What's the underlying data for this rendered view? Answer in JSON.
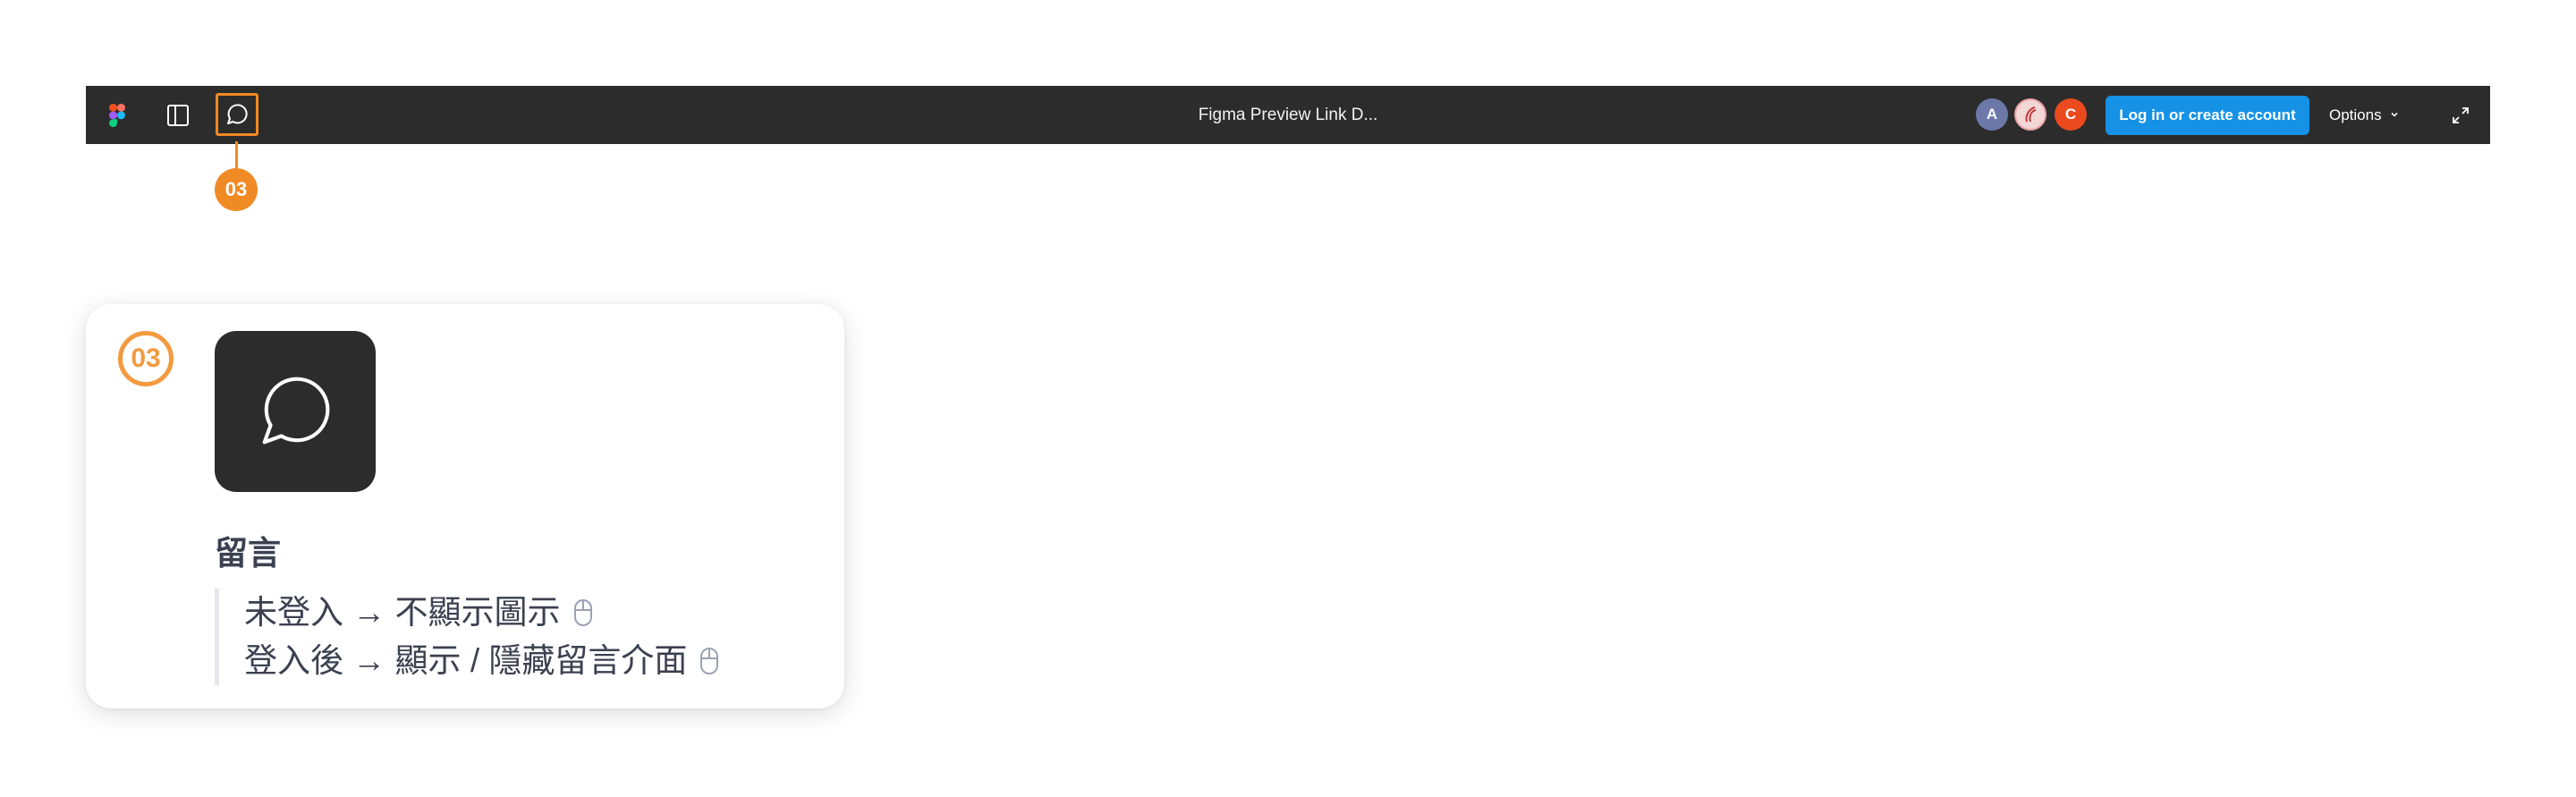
{
  "toolbar": {
    "file_title": "Figma Preview Link D...",
    "avatars": [
      {
        "initial": "A",
        "color": "#6b78a8"
      },
      {
        "initial": "",
        "color": "#f3d6d6"
      },
      {
        "initial": "C",
        "color": "#ea4a1e"
      }
    ],
    "login_label": "Log in or create account",
    "options_label": "Options",
    "icons": [
      "figma-logo",
      "sidebar-icon",
      "comment-icon",
      "chevron-down-icon",
      "expand-icon"
    ]
  },
  "marker": {
    "label": "03",
    "color": "#f08a24"
  },
  "card": {
    "number": "03",
    "icon": "comment-icon",
    "title": "留言",
    "lines": [
      "未登入 → 不顯示圖示",
      "登入後 → 顯示 / 隱藏留言介面"
    ],
    "line_icon": "mouse-icon"
  },
  "colors": {
    "toolbar_bg": "#2c2c2c",
    "accent": "#f08a24",
    "login_button": "#1592e6",
    "text": "#3b4150"
  }
}
